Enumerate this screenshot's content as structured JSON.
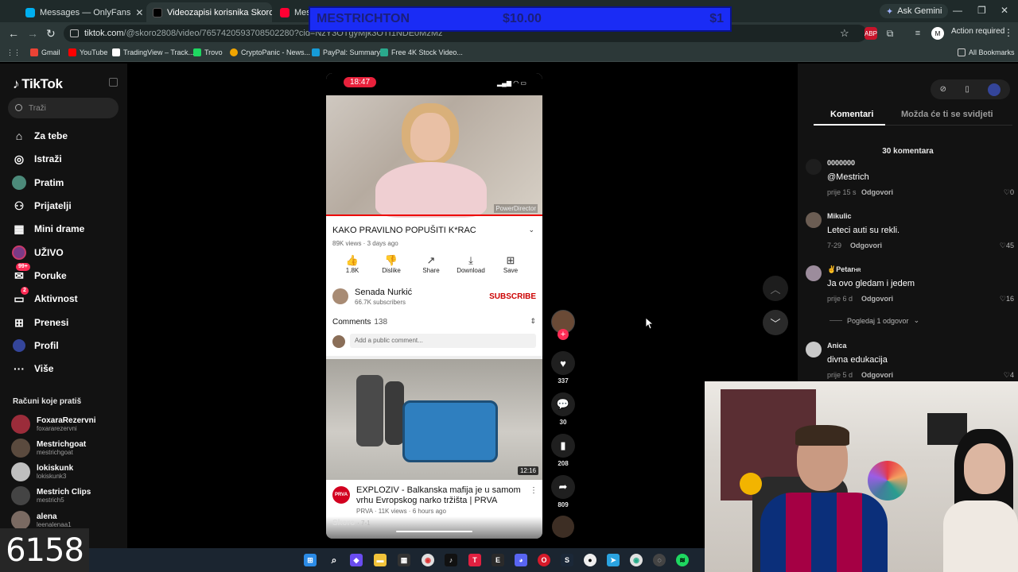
{
  "browser": {
    "tabs": [
      {
        "label": "Messages — OnlyFans",
        "active": false
      },
      {
        "label": "Videozapisi korisnika Skoro",
        "active": true
      },
      {
        "label": "Mestri",
        "active": false
      }
    ],
    "ask_gemini": "Ask Gemini",
    "url_main": "tiktok.com",
    "url_rest": "/@skoro2808/video/7657420593708502280?cid=NzY3OTgyMjk3OTI1NDE0MzMz",
    "action_required": "Action required",
    "bookmarks": [
      {
        "label": "Gmail",
        "color": "#ea4335"
      },
      {
        "label": "YouTube",
        "color": "#ff0000"
      },
      {
        "label": "TradingView – Track...",
        "color": "#ffffff"
      },
      {
        "label": "Trovo",
        "color": "#1ed760"
      },
      {
        "label": "CryptoPanic - News...",
        "color": "#f0a500"
      },
      {
        "label": "PayPal: Summary",
        "color": "#169bd7"
      },
      {
        "label": "Free 4K Stock Video...",
        "color": "#2aa98c"
      }
    ],
    "all_bookmarks": "All Bookmarks"
  },
  "promo_banner": {
    "name": "MESTRICHTON",
    "amount": "$10.00",
    "right": "$1"
  },
  "sidebar": {
    "logo": "TikTok",
    "search_placeholder": "Traži",
    "nav": [
      {
        "label": "Za tebe",
        "icon": "home-icon"
      },
      {
        "label": "Istraži",
        "icon": "compass-icon"
      },
      {
        "label": "Pratim",
        "icon": "following-icon"
      },
      {
        "label": "Prijatelji",
        "icon": "friends-icon"
      },
      {
        "label": "Mini drame",
        "icon": "mini-drama-icon"
      },
      {
        "label": "UŽIVO",
        "icon": "live-icon"
      },
      {
        "label": "Poruke",
        "icon": "messages-icon",
        "badge": "99+"
      },
      {
        "label": "Aktivnost",
        "icon": "activity-icon",
        "badge": "2"
      },
      {
        "label": "Prenesi",
        "icon": "upload-icon"
      },
      {
        "label": "Profil",
        "icon": "profile-icon"
      },
      {
        "label": "Više",
        "icon": "more-icon"
      }
    ],
    "following_title": "Računi koje pratiš",
    "following": [
      {
        "name": "FoxaraRezervni",
        "handle": "foxararezervni",
        "color": "#9b2c3a"
      },
      {
        "name": "Mestrichgoat",
        "handle": "mestrichgoat",
        "color": "#5a4a3e"
      },
      {
        "name": "lokiskunk",
        "handle": "lokiskunk3",
        "color": "#bfbfbf"
      },
      {
        "name": "Mestrich Clips",
        "handle": "mestrich5",
        "color": "#444"
      },
      {
        "name": "alena",
        "handle": "leenalenaa1",
        "color": "#7a6a62"
      }
    ],
    "counter": "6158"
  },
  "video": {
    "clock": "18:47",
    "yt_title": "KAKO PRAVILNO POPUŠITI K*RAC",
    "yt_meta": "89K views · 3 days ago",
    "watermark": "PowerDirector",
    "actions": [
      {
        "label": "1.8K",
        "icon": "like-icon",
        "glyph": "👍"
      },
      {
        "label": "Dislike",
        "icon": "dislike-icon",
        "glyph": "👎"
      },
      {
        "label": "Share",
        "icon": "share-icon",
        "glyph": "↗"
      },
      {
        "label": "Download",
        "icon": "download-icon",
        "glyph": "⤓"
      },
      {
        "label": "Save",
        "icon": "save-icon",
        "glyph": "⊞"
      }
    ],
    "channel_name": "Senada Nurkić",
    "channel_subs": "66.7K subscribers",
    "subscribe": "SUBSCRIBE",
    "comments_label": "Comments",
    "comments_count": "138",
    "comment_placeholder": "Add a public comment...",
    "video2_duration": "12:16",
    "video2_channel_badge": "PRVA",
    "video2_title": "EXPLOZIV - Balkanska mafija je u samom vrhu Evropskog narko tržišta | PRVA",
    "video2_meta": "PRVA · 11K views · 6 hours ago",
    "tt_author": "Skoro",
    "tt_date": "· 7-1"
  },
  "rail": {
    "likes": "337",
    "comments": "30",
    "saves": "208",
    "shares": "809"
  },
  "comments_panel": {
    "tab_comments": "Komentari",
    "tab_suggest": "Možda će ti se svidjeti",
    "count": "30 komentara",
    "reply_label": "Odgovori",
    "view_replies": "Pogledaj 1 odgovor",
    "items": [
      {
        "user": "0000000",
        "text": "@Mestrich",
        "date": "prije 15 s",
        "likes": "0",
        "color": "#1e1e1e"
      },
      {
        "user": "Mikulic",
        "text": "Leteci auti su rekli.",
        "date": "7-29",
        "likes": "45",
        "color": "#6b5d53"
      },
      {
        "user": "✌Petar",
        "user_tag": "HR",
        "text": "Ja ovo gledam i jedem",
        "date": "prije 6 d",
        "likes": "16",
        "color": "#9c8c9c"
      },
      {
        "user": "Anica",
        "text": "divna edukacija",
        "date": "prije 5 d",
        "likes": "4",
        "color": "#c9c9c9"
      }
    ]
  }
}
